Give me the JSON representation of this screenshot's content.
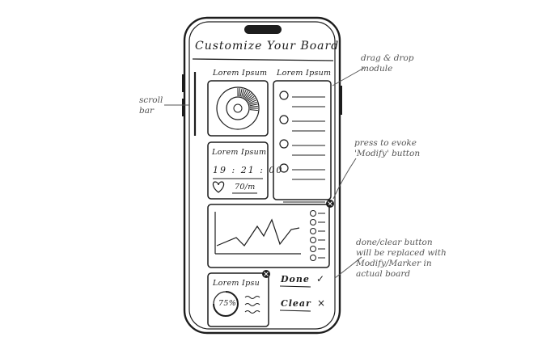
{
  "screen": {
    "title": "Customize Your Board"
  },
  "cards": {
    "donut_card": {
      "title": "Lorem Ipsum"
    },
    "list_card": {
      "title": "Lorem Ipsum",
      "rows": 5
    },
    "time_card": {
      "title": "Lorem Ipsum",
      "time": "19 : 21 : 00",
      "rate": "70/m"
    },
    "chart_card": {
      "rows": 6
    },
    "percent_card": {
      "title": "Lorem Ipsu",
      "percent": "75%",
      "progress": 0.75
    }
  },
  "actions": {
    "done_label": "Done",
    "done_glyph": "✓",
    "clear_label": "Clear",
    "clear_glyph": "×"
  },
  "annotations": {
    "scroll_bar": "scroll bar",
    "drag_drop": "drag & drop module",
    "press_modify": "press to evoke 'Modify' button",
    "done_clear": "done/clear button will be replaced with Modify/Marker in actual board"
  },
  "icons": {
    "heart": "heart-icon",
    "modify": "modify-dot-icon",
    "check": "check-icon",
    "close": "close-icon"
  }
}
